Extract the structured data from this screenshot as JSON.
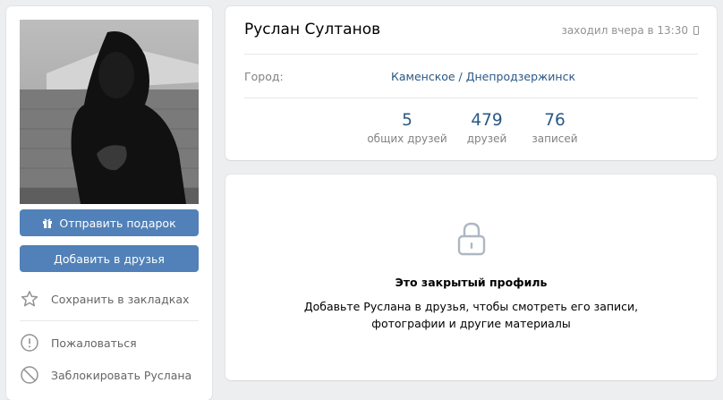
{
  "sidebar": {
    "gift_button": "Отправить подарок",
    "add_friend_button": "Добавить в друзья",
    "menu": [
      {
        "label": "Сохранить в закладках",
        "icon": "star-icon"
      },
      {
        "label": "Пожаловаться",
        "icon": "warning-icon"
      },
      {
        "label": "Заблокировать Руслана",
        "icon": "block-icon"
      }
    ]
  },
  "profile": {
    "name": "Руслан Султанов",
    "last_seen": "заходил вчера в 13:30",
    "city_label": "Город:",
    "city_value": "Каменское / Днепродзержинск",
    "counters": [
      {
        "value": "5",
        "label": "общих друзей"
      },
      {
        "value": "479",
        "label": "друзей"
      },
      {
        "value": "76",
        "label": "записей"
      }
    ]
  },
  "closed": {
    "title": "Это закрытый профиль",
    "line1": "Добавьте Руслана в друзья, чтобы смотреть его записи,",
    "line2": "фотографии и другие материалы"
  },
  "colors": {
    "accent": "#5181b8",
    "link": "#2a5885",
    "background": "#edeef0"
  }
}
